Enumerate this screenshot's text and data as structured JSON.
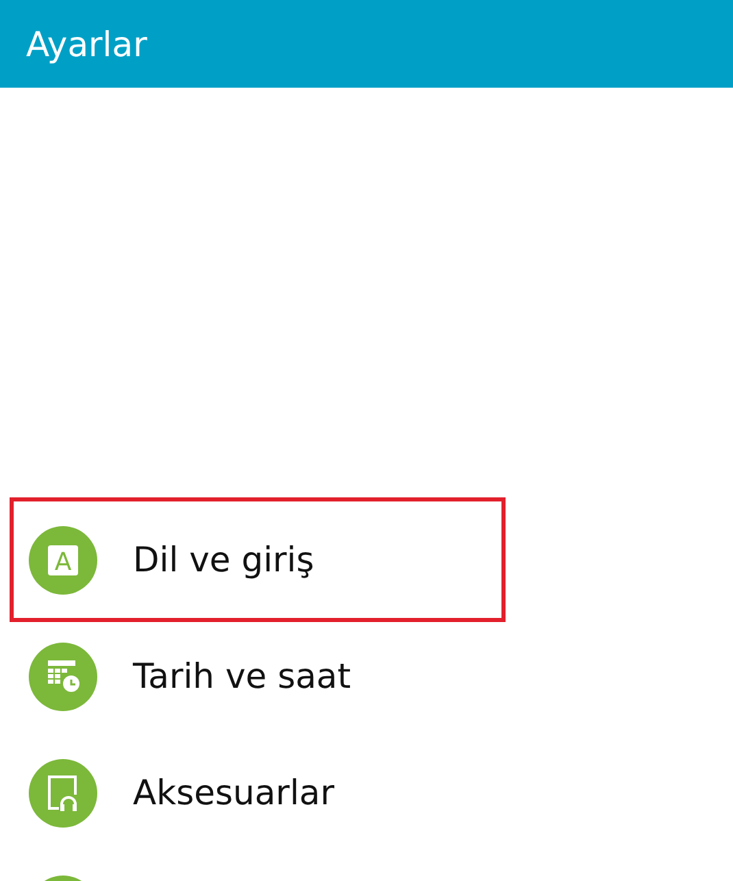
{
  "window": {
    "title": "Ayarlar"
  },
  "items": [
    {
      "kind": "language",
      "glyph": "A",
      "label": "Dil ve giriş",
      "highlighted": true
    },
    {
      "kind": "datetime",
      "label": "Tarih ve saat",
      "highlighted": false
    },
    {
      "kind": "accessories",
      "label": "Aksesuarlar",
      "highlighted": false
    },
    {
      "kind": "partial",
      "highlighted": false
    }
  ]
}
